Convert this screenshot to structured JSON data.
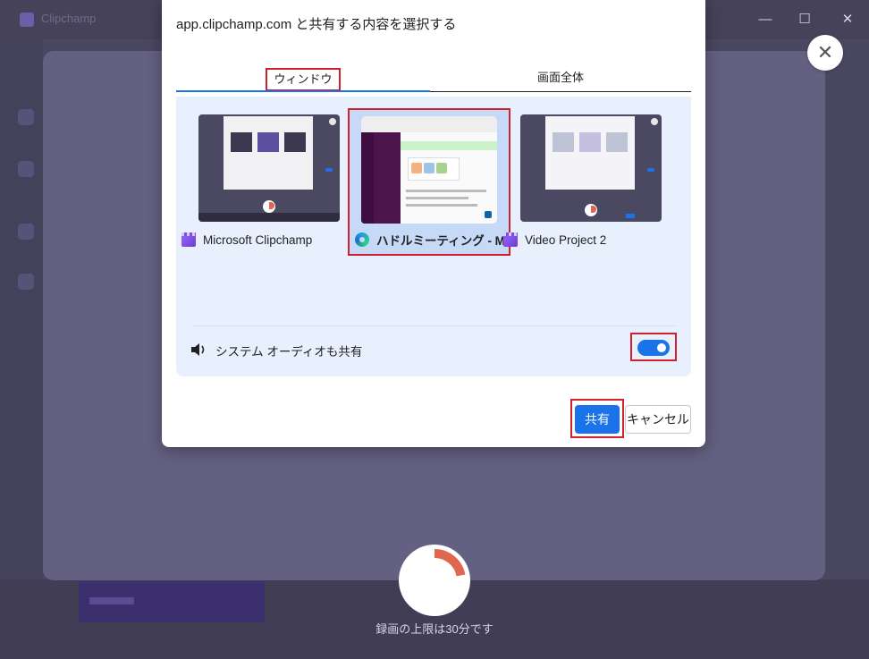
{
  "background_app": {
    "title": "Clipchamp"
  },
  "window_controls": {
    "minimize": "—",
    "maximize": "☐",
    "close": "✕"
  },
  "overlay": {
    "close_glyph": "✕",
    "recording_limit_text": "録画の上限は30分です",
    "timer_progress": 0.22
  },
  "dialog": {
    "title": "app.clipchamp.com と共有する内容を選択する",
    "tabs": [
      {
        "label": "ウィンドウ",
        "selected": true
      },
      {
        "label": "画面全体",
        "selected": false
      }
    ],
    "sources": [
      {
        "label": "Microsoft Clipchamp",
        "icon": "clipchamp-icon",
        "selected": false
      },
      {
        "label": "ハドルミーティング - M...",
        "icon": "edge-icon",
        "selected": true
      },
      {
        "label": "Video Project 2",
        "icon": "clipchamp-icon",
        "selected": false
      }
    ],
    "audio": {
      "label": "システム オーディオも共有",
      "enabled": true
    },
    "buttons": {
      "share": "共有",
      "cancel": "キャンセル"
    }
  },
  "colors": {
    "accent": "#1a73e8",
    "highlight_box": "#d02030",
    "panel_bg": "#e8f0fe",
    "overlay_bg": "#646082",
    "timer_arc": "#e0664f"
  }
}
